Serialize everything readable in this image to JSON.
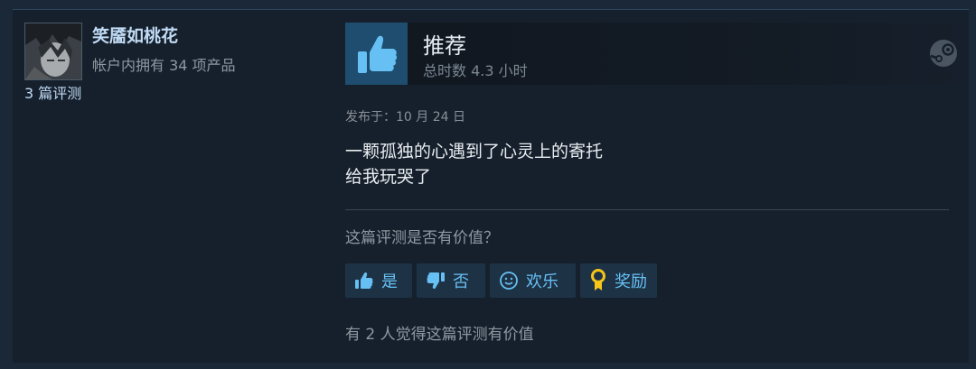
{
  "author": {
    "name": "笑靥如桃花",
    "products_owned": "帐户内拥有 34 项产品",
    "review_count": "3 篇评测"
  },
  "review": {
    "verdict": "推荐",
    "hours": "总时数 4.3 小时",
    "posted": "发布于：10 月 24 日",
    "content_lines": [
      "一颗孤独的心遇到了心灵上的寄托",
      "给我玩哭了"
    ]
  },
  "helpful": {
    "question": "这篇评测是否有价值？",
    "buttons": {
      "yes": "是",
      "no": "否",
      "funny": "欢乐",
      "award": "奖励"
    },
    "summary": "有 2 人觉得这篇评测有价值"
  },
  "colors": {
    "accent": "#66c0f4",
    "thumb_bg": "#1e4d6f",
    "card_bg": "#16202d",
    "button_bg": "#1e3246"
  },
  "icons": {
    "avatar": "avatar-image",
    "verdict": "thumbs-up-icon",
    "platform": "steam-logo-icon",
    "yes": "thumbs-up-icon",
    "no": "thumbs-down-icon",
    "funny": "smiley-icon",
    "award": "award-ribbon-icon"
  }
}
